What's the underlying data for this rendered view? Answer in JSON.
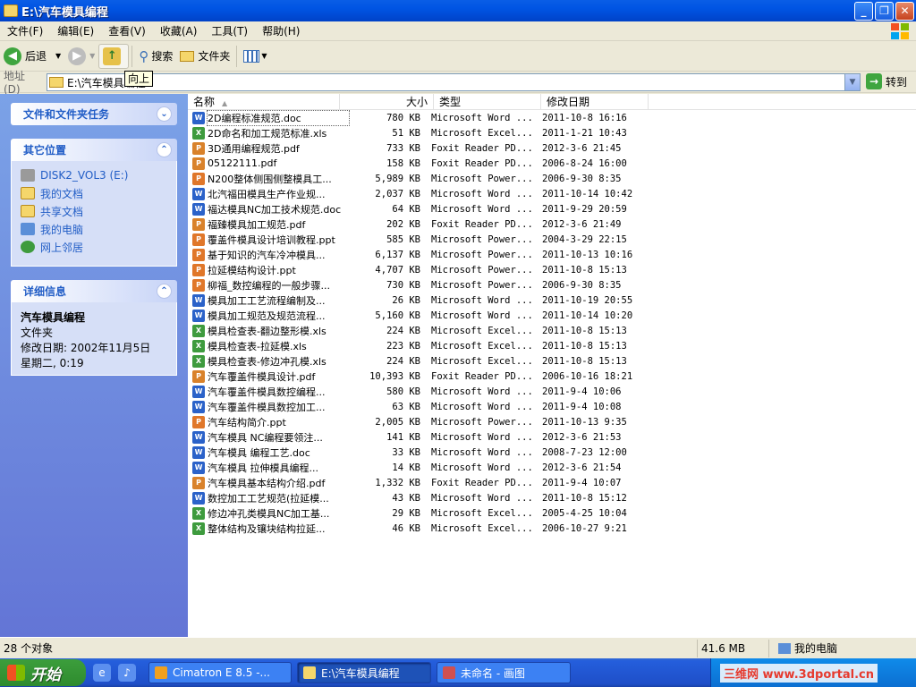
{
  "window": {
    "title": "E:\\汽车模具编程"
  },
  "menu": [
    "文件(F)",
    "编辑(E)",
    "查看(V)",
    "收藏(A)",
    "工具(T)",
    "帮助(H)"
  ],
  "toolbar": {
    "back": "后退",
    "search": "搜索",
    "folders": "文件夹",
    "tooltip": "向上"
  },
  "address": {
    "label": "地址(D)",
    "path": "E:\\汽车模具编程",
    "go": "转到"
  },
  "left": {
    "tasks_title": "文件和文件夹任务",
    "other_title": "其它位置",
    "other_items": [
      "DISK2_VOL3 (E:)",
      "我的文档",
      "共享文档",
      "我的电脑",
      "网上邻居"
    ],
    "details_title": "详细信息",
    "details_name": "汽车模具编程",
    "details_type": "文件夹",
    "details_date": "修改日期: 2002年11月5日",
    "details_day": "星期二, 0:19"
  },
  "columns": [
    "名称",
    "大小",
    "类型",
    "修改日期"
  ],
  "files": [
    {
      "name": "2D编程标准规范.doc",
      "size": "780 KB",
      "type": "Microsoft Word ...",
      "date": "2011-10-8 16:16",
      "kind": "word"
    },
    {
      "name": "2D命名和加工规范标准.xls",
      "size": "51 KB",
      "type": "Microsoft Excel...",
      "date": "2011-1-21 10:43",
      "kind": "excel"
    },
    {
      "name": "3D通用编程规范.pdf",
      "size": "733 KB",
      "type": "Foxit Reader PD...",
      "date": "2012-3-6 21:45",
      "kind": "pdf"
    },
    {
      "name": "05122111.pdf",
      "size": "158 KB",
      "type": "Foxit Reader PD...",
      "date": "2006-8-24 16:00",
      "kind": "pdf"
    },
    {
      "name": "N200整体侧围侧整模具工...",
      "size": "5,989 KB",
      "type": "Microsoft Power...",
      "date": "2006-9-30 8:35",
      "kind": "ppt"
    },
    {
      "name": "北汽福田模具生产作业规...",
      "size": "2,037 KB",
      "type": "Microsoft Word ...",
      "date": "2011-10-14 10:42",
      "kind": "word"
    },
    {
      "name": "福达模具NC加工技术规范.doc",
      "size": "64 KB",
      "type": "Microsoft Word ...",
      "date": "2011-9-29 20:59",
      "kind": "word"
    },
    {
      "name": "福臻模具加工规范.pdf",
      "size": "202 KB",
      "type": "Foxit Reader PD...",
      "date": "2012-3-6 21:49",
      "kind": "pdf"
    },
    {
      "name": "覆盖件模具设计培训教程.ppt",
      "size": "585 KB",
      "type": "Microsoft Power...",
      "date": "2004-3-29 22:15",
      "kind": "ppt"
    },
    {
      "name": "基于知识的汽车冷冲模具...",
      "size": "6,137 KB",
      "type": "Microsoft Power...",
      "date": "2011-10-13 10:16",
      "kind": "ppt"
    },
    {
      "name": "拉延模结构设计.ppt",
      "size": "4,707 KB",
      "type": "Microsoft Power...",
      "date": "2011-10-8 15:13",
      "kind": "ppt"
    },
    {
      "name": "柳福_数控编程的一般步骤...",
      "size": "730 KB",
      "type": "Microsoft Power...",
      "date": "2006-9-30 8:35",
      "kind": "ppt"
    },
    {
      "name": "模具加工工艺流程编制及...",
      "size": "26 KB",
      "type": "Microsoft Word ...",
      "date": "2011-10-19 20:55",
      "kind": "word"
    },
    {
      "name": "模具加工规范及规范流程...",
      "size": "5,160 KB",
      "type": "Microsoft Word ...",
      "date": "2011-10-14 10:20",
      "kind": "word"
    },
    {
      "name": "模具检查表-翻边整形模.xls",
      "size": "224 KB",
      "type": "Microsoft Excel...",
      "date": "2011-10-8 15:13",
      "kind": "excel"
    },
    {
      "name": "模具检查表-拉延模.xls",
      "size": "223 KB",
      "type": "Microsoft Excel...",
      "date": "2011-10-8 15:13",
      "kind": "excel"
    },
    {
      "name": "模具检查表-修边冲孔模.xls",
      "size": "224 KB",
      "type": "Microsoft Excel...",
      "date": "2011-10-8 15:13",
      "kind": "excel"
    },
    {
      "name": "汽车覆盖件模具设计.pdf",
      "size": "10,393 KB",
      "type": "Foxit Reader PD...",
      "date": "2006-10-16 18:21",
      "kind": "pdf"
    },
    {
      "name": "汽车覆盖件模具数控编程...",
      "size": "580 KB",
      "type": "Microsoft Word ...",
      "date": "2011-9-4 10:06",
      "kind": "word"
    },
    {
      "name": "汽车覆盖件模具数控加工...",
      "size": "63 KB",
      "type": "Microsoft Word ...",
      "date": "2011-9-4 10:08",
      "kind": "word"
    },
    {
      "name": "汽车结构简介.ppt",
      "size": "2,005 KB",
      "type": "Microsoft Power...",
      "date": "2011-10-13 9:35",
      "kind": "ppt"
    },
    {
      "name": "汽车模具  NC编程要领注...",
      "size": "141 KB",
      "type": "Microsoft Word ...",
      "date": "2012-3-6 21:53",
      "kind": "word"
    },
    {
      "name": "汽车模具  编程工艺.doc",
      "size": "33 KB",
      "type": "Microsoft Word ...",
      "date": "2008-7-23 12:00",
      "kind": "word"
    },
    {
      "name": "汽车模具  拉伸模具编程...",
      "size": "14 KB",
      "type": "Microsoft Word ...",
      "date": "2012-3-6 21:54",
      "kind": "word"
    },
    {
      "name": "汽车模具基本结构介绍.pdf",
      "size": "1,332 KB",
      "type": "Foxit Reader PD...",
      "date": "2011-9-4 10:07",
      "kind": "pdf"
    },
    {
      "name": "数控加工工艺规范(拉延模...",
      "size": "43 KB",
      "type": "Microsoft Word ...",
      "date": "2011-10-8 15:12",
      "kind": "word"
    },
    {
      "name": "修边冲孔类模具NC加工基...",
      "size": "29 KB",
      "type": "Microsoft Excel...",
      "date": "2005-4-25 10:04",
      "kind": "excel"
    },
    {
      "name": "整体结构及镶块结构拉延...",
      "size": "46 KB",
      "type": "Microsoft Excel...",
      "date": "2006-10-27 9:21",
      "kind": "excel"
    }
  ],
  "kind_colors": {
    "word": "#2B62C9",
    "excel": "#3E9B3E",
    "pdf": "#D9822B",
    "ppt": "#E0772A"
  },
  "status": {
    "count": "28 个对象",
    "size": "41.6 MB",
    "location": "我的电脑"
  },
  "taskbar": {
    "start": "开始",
    "tasks": [
      "Cimatron E 8.5 -...",
      "E:\\汽车模具编程",
      "未命名 - 画图"
    ],
    "watermark": "三维网 www.3dportal.cn"
  }
}
